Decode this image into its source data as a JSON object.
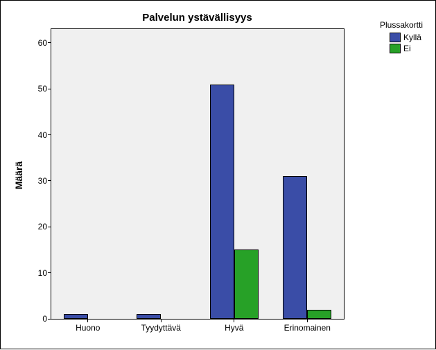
{
  "chart_data": {
    "type": "bar",
    "title": "Palvelun ystävällisyys",
    "ylabel": "Määrä",
    "xlabel": "",
    "legend_title": "Plussakortti",
    "categories": [
      "Huono",
      "Tyydyttävä",
      "Hyvä",
      "Erinomainen"
    ],
    "series": [
      {
        "name": "Kyllä",
        "color": "#3a4da7",
        "values": [
          1,
          1,
          51,
          31
        ]
      },
      {
        "name": "Ei",
        "color": "#27a127",
        "values": [
          0,
          0,
          15,
          2
        ]
      }
    ],
    "yticks": [
      0,
      10,
      20,
      30,
      40,
      50,
      60
    ],
    "ylim": [
      0,
      63
    ]
  }
}
